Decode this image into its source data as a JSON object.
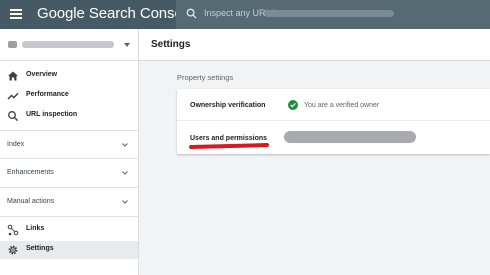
{
  "app": {
    "title": "Google Search Console",
    "search_placeholder": "Inspect any URL in",
    "colors": {
      "topbar": "#455a64",
      "check": "#1e8e3e",
      "underline": "#d71920"
    }
  },
  "sidebar": {
    "nav": [
      {
        "label": "Overview",
        "icon": "home-icon"
      },
      {
        "label": "Performance",
        "icon": "trending-up-icon"
      },
      {
        "label": "URL inspection",
        "icon": "search-icon"
      }
    ],
    "sections": [
      {
        "label": "Index"
      },
      {
        "label": "Enhancements"
      },
      {
        "label": "Manual actions"
      }
    ],
    "bottom": [
      {
        "label": "Links",
        "icon": "links-icon"
      },
      {
        "label": "Settings",
        "icon": "gear-icon",
        "active": true
      }
    ]
  },
  "main": {
    "title": "Settings",
    "section_title": "Property settings",
    "rows": [
      {
        "label": "Ownership verification",
        "status": "You are a verified owner"
      },
      {
        "label": "Users and permissions"
      }
    ]
  }
}
